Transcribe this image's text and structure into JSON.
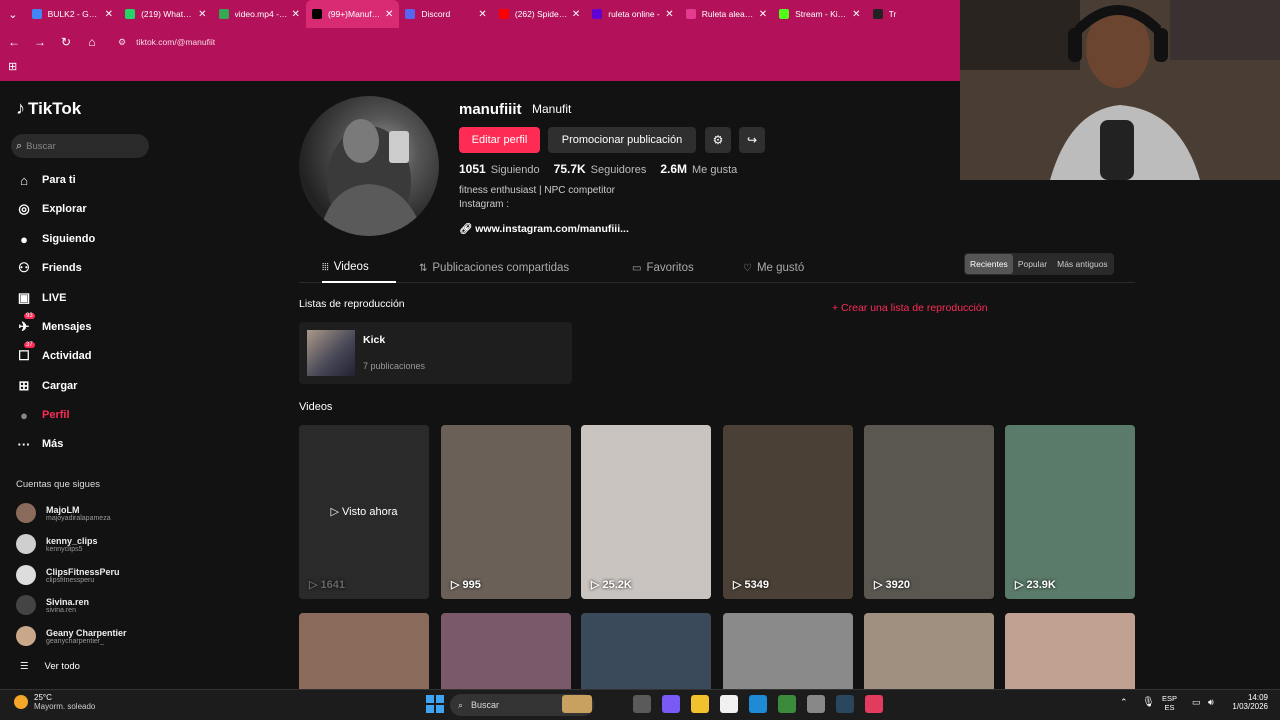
{
  "browser": {
    "tabs": [
      {
        "title": "BULK2 - Googl",
        "color": "#4285f4"
      },
      {
        "title": "(219) WhatsAp",
        "color": "#25d366"
      },
      {
        "title": "video.mp4 - G",
        "color": "#34a853"
      },
      {
        "title": "(99+)Manufit (",
        "color": "#000000",
        "active": true
      },
      {
        "title": "Discord",
        "color": "#5865f2"
      },
      {
        "title": "(262) Spider-M",
        "color": "#ff0000"
      },
      {
        "title": "ruleta online -",
        "color": "#6001d2"
      },
      {
        "title": "Ruleta aleatori",
        "color": "#e33b8e"
      },
      {
        "title": "Stream - Kick D",
        "color": "#53fc18"
      },
      {
        "title": "Tr",
        "color": "#222222"
      }
    ],
    "url": "tiktok.com/@manufiit"
  },
  "sidebar": {
    "logo": "TikTok",
    "search_placeholder": "Buscar",
    "items": [
      {
        "label": "Para ti",
        "icon": "home-icon",
        "glyph": "⌂"
      },
      {
        "label": "Explorar",
        "icon": "compass-icon",
        "glyph": "◎"
      },
      {
        "label": "Siguiendo",
        "icon": "following-icon",
        "glyph": "●"
      },
      {
        "label": "Friends",
        "icon": "friends-icon",
        "glyph": "⚇"
      },
      {
        "label": "LIVE",
        "icon": "live-icon",
        "glyph": "▣"
      },
      {
        "label": "Mensajes",
        "icon": "messages-icon",
        "glyph": "✈",
        "badge": "93"
      },
      {
        "label": "Actividad",
        "icon": "activity-icon",
        "glyph": "☐",
        "badge": "37"
      },
      {
        "label": "Cargar",
        "icon": "upload-icon",
        "glyph": "⊞"
      },
      {
        "label": "Perfil",
        "icon": "profile-icon",
        "glyph": "●",
        "active": true
      },
      {
        "label": "Más",
        "icon": "more-icon",
        "glyph": "···"
      }
    ],
    "following_header": "Cuentas que sigues",
    "accounts": [
      {
        "name": "MajoLM",
        "handle": "majoyadiralapameza",
        "color": "#8a6a5a"
      },
      {
        "name": "kenny_clips",
        "handle": "kennyclips5",
        "color": "#cfcfcf"
      },
      {
        "name": "ClipsFitnessPeru",
        "handle": "clipsfitnessperu",
        "color": "#dddddd"
      },
      {
        "name": "Sivina.ren",
        "handle": "sivina.ren",
        "color": "#444444"
      },
      {
        "name": "Geany Charpentier",
        "handle": "geanycharpentier_",
        "color": "#c9a88a"
      }
    ],
    "see_all": "Ver todo"
  },
  "profile": {
    "username": "manufiiit",
    "nickname": "Manufit",
    "edit_button": "Editar perfil",
    "promote_button": "Promocionar publicación",
    "stats": [
      {
        "value": "1051",
        "label": "Siguiendo"
      },
      {
        "value": "75.7K",
        "label": "Seguidores"
      },
      {
        "value": "2.6M",
        "label": "Me gusta"
      }
    ],
    "bio_line1": "fitness enthusiast | NPC competitor",
    "bio_line2": "Instagram :",
    "link": "www.instagram.com/manufiii..."
  },
  "profile_tabs": [
    {
      "label": "Videos",
      "icon": "grid-icon",
      "glyph": "⦙⦙⦙",
      "active": true
    },
    {
      "label": "Publicaciones compartidas",
      "icon": "repost-icon",
      "glyph": "⇅"
    },
    {
      "label": "Favoritos",
      "icon": "bookmark-icon",
      "glyph": "▭"
    },
    {
      "label": "Me gustó",
      "icon": "heart-icon",
      "glyph": "♡"
    }
  ],
  "sort_options": [
    {
      "label": "Recientes",
      "active": true
    },
    {
      "label": "Popular"
    },
    {
      "label": "Más antiguos"
    }
  ],
  "playlists": {
    "header": "Listas de reproducción",
    "create": "+ Crear una lista de reproducción",
    "items": [
      {
        "name": "Kick",
        "count": "7 publicaciones"
      }
    ]
  },
  "videos": {
    "header": "Videos",
    "items": [
      {
        "views": "1641",
        "seen": "▷ Visto ahora",
        "bg": "#2a2a2a"
      },
      {
        "views": "995",
        "bg": "#6a6058"
      },
      {
        "views": "25.2K",
        "bg": "#c9c4bf"
      },
      {
        "views": "5349",
        "bg": "#4a4036"
      },
      {
        "views": "3920",
        "bg": "#5a5650"
      },
      {
        "views": "23.9K",
        "bg": "#5a7a6a"
      }
    ],
    "row2": [
      {
        "bg": "#8a6a5a"
      },
      {
        "bg": "#7a5a6a"
      },
      {
        "bg": "#3a4a5a"
      },
      {
        "bg": "#8a8a8a"
      },
      {
        "bg": "#a09080"
      },
      {
        "bg": "#c0a090"
      }
    ]
  },
  "taskbar": {
    "temp": "25°C",
    "weather": "Mayorm. soleado",
    "search": "Buscar",
    "lang1": "ESP",
    "lang2": "ES",
    "time": "14:09",
    "date": "1/03/2026"
  }
}
